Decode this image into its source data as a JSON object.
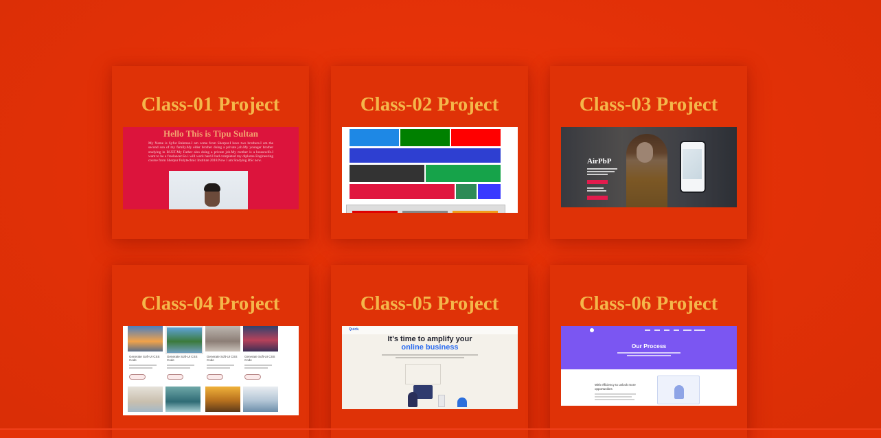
{
  "projects": [
    {
      "title": "Class-01 Project",
      "thumb": {
        "heading": "Hello This is Tipu Sultan",
        "paragraph": "My Name is Syfur Rahman.I am come from Sherpur.I have two brothers.I am the second son of my family.My elder brother doing a private job.My younger brother studying in RUET.My Father also doing a private job.My mother is a housewife.I want to be a freelancer.So i will work hard.I had completed my diploma Engineering course from Sherpur Polytechnic Institute 2018.Now I am Studying BSc now."
      }
    },
    {
      "title": "Class-02 Project"
    },
    {
      "title": "Class-03 Project",
      "thumb": {
        "brand": "AirPbP"
      }
    },
    {
      "title": "Class-04 Project",
      "thumb": {
        "caption": "Generate Soft-UI CSS Code"
      }
    },
    {
      "title": "Class-05 Project",
      "thumb": {
        "logo": "Quick.",
        "headline": "It's time to amplify your",
        "headline_accent": "online business"
      }
    },
    {
      "title": "Class-06 Project",
      "thumb": {
        "section_title": "Our Process",
        "feature": "With efficiency to unlock more opportunities"
      }
    }
  ],
  "colors": {
    "background": "#e43208",
    "card": "#df3207",
    "title": "#f4b64a"
  }
}
